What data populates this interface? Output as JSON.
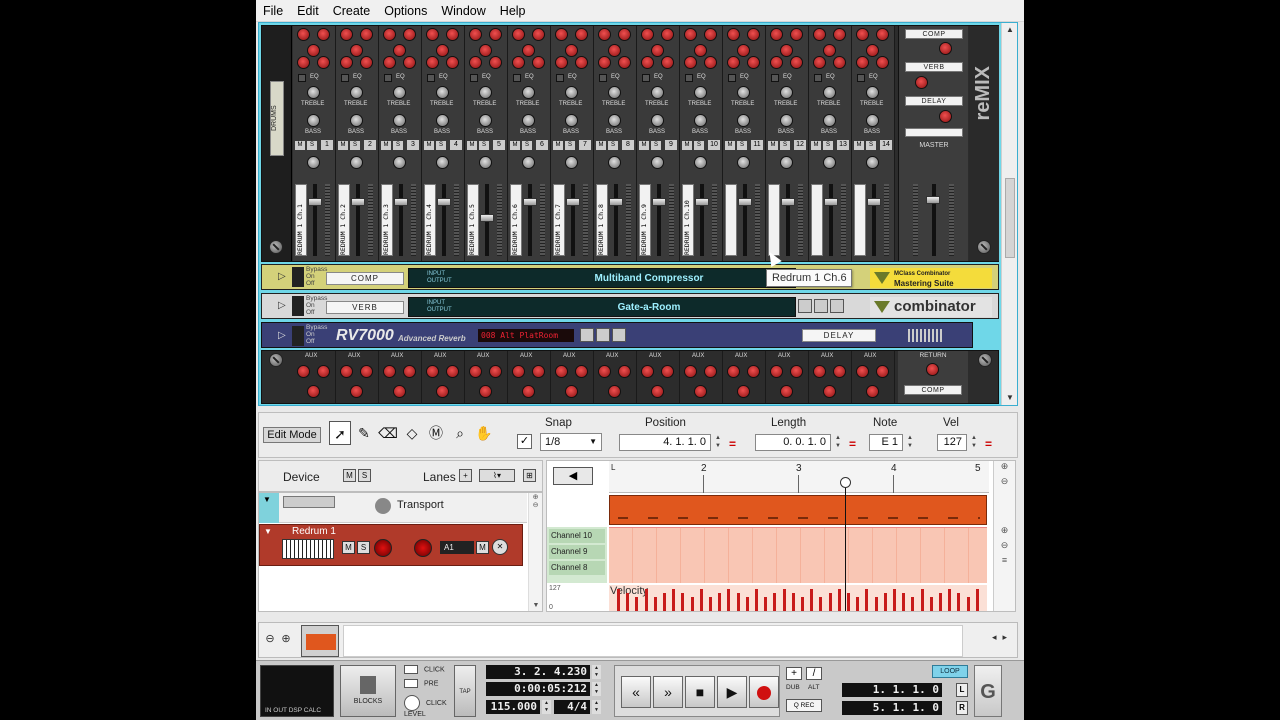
{
  "menu": [
    "File",
    "Edit",
    "Create",
    "Options",
    "Window",
    "Help"
  ],
  "rack": {
    "mixer": {
      "drums_tag": "DRUMS",
      "eq_label": "EQ",
      "treble_label": "TREBLE",
      "bass_label": "BASS",
      "mute_label": "M",
      "solo_label": "S",
      "channels": [
        {
          "num": "1",
          "name": "REDRUM 1 Ch.1"
        },
        {
          "num": "2",
          "name": "REDRUM 1 Ch.2"
        },
        {
          "num": "3",
          "name": "REDRUM 1 Ch.3"
        },
        {
          "num": "4",
          "name": "REDRUM 1 Ch.4"
        },
        {
          "num": "5",
          "name": "REDRUM 1 Ch.5"
        },
        {
          "num": "6",
          "name": "REDRUM 1 Ch.6"
        },
        {
          "num": "7",
          "name": "REDRUM 1 Ch.7"
        },
        {
          "num": "8",
          "name": "REDRUM 1 Ch.8"
        },
        {
          "num": "9",
          "name": "REDRUM 1 Ch.9"
        },
        {
          "num": "10",
          "name": "REDRUM 1 Ch.10"
        },
        {
          "num": "11",
          "name": ""
        },
        {
          "num": "12",
          "name": ""
        },
        {
          "num": "13",
          "name": ""
        },
        {
          "num": "14",
          "name": ""
        }
      ],
      "master": {
        "fx1": "COMP",
        "fx2": "VERB",
        "fx3": "DELAY",
        "label": "MASTER"
      },
      "logo": "reMIX"
    },
    "combinators": [
      {
        "name": "COMP",
        "patch": "Multiband Compressor",
        "brand": "Mastering Suite",
        "brand_sub": "MClass Combinator",
        "bypass": "Bypass",
        "on": "On",
        "off": "Off",
        "input": "INPUT",
        "output": "OUTPUT"
      },
      {
        "name": "VERB",
        "patch": "Gate-a-Room",
        "brand": "combinator",
        "bypass": "Bypass",
        "on": "On",
        "off": "Off",
        "input": "INPUT",
        "output": "OUTPUT"
      }
    ],
    "rv7000": {
      "name": "RV7000",
      "subtitle": "Advanced Reverb",
      "display": "008 Alt PlatRoom",
      "label": "DELAY",
      "bypass": "Bypass",
      "on": "On",
      "off": "Off"
    },
    "aux": {
      "label": "AUX",
      "return_label": "RETURN",
      "return_fx": "COMP"
    },
    "tooltip": "Redrum 1 Ch.6"
  },
  "toolbar": {
    "edit_mode": "Edit Mode",
    "snap_label": "Snap",
    "snap_checked": "✓",
    "snap_value": "1/8",
    "position_label": "Position",
    "position_value": "4. 1. 1.   0",
    "length_label": "Length",
    "length_value": "0. 0. 1.   0",
    "note_label": "Note",
    "note_value": "E 1",
    "vel_label": "Vel",
    "vel_value": "127"
  },
  "tracks": {
    "device_label": "Device",
    "lanes_label": "Lanes",
    "transport_name": "Transport",
    "redrum_name": "Redrum 1",
    "lane_select": "A1"
  },
  "arrange": {
    "ruler": [
      "2",
      "3",
      "4",
      "5"
    ],
    "lanes": [
      "Channel 10",
      "Channel 9",
      "Channel 8"
    ],
    "velocity_label": "Velocity",
    "vel_max": "127",
    "vel_min": "0"
  },
  "transport": {
    "dsp_label": "IN  OUT DSP CALC",
    "blocks_label": "BLOCKS",
    "click_label": "CLICK",
    "pre_label": "PRE",
    "click_level_label": "CLICK LEVEL",
    "tap_label": "TAP",
    "bars": "3. 2. 4.230",
    "time": "0:00:05:212",
    "tempo": "115.000",
    "signature": "4/4",
    "dub_label": "DUB",
    "alt_label": "ALT",
    "qrec_label": "Q REC",
    "loop_label": "LOOP",
    "left_locator": "1. 1. 1.    0",
    "right_locator": "5. 1. 1.    0",
    "l_label": "L",
    "r_label": "R"
  }
}
